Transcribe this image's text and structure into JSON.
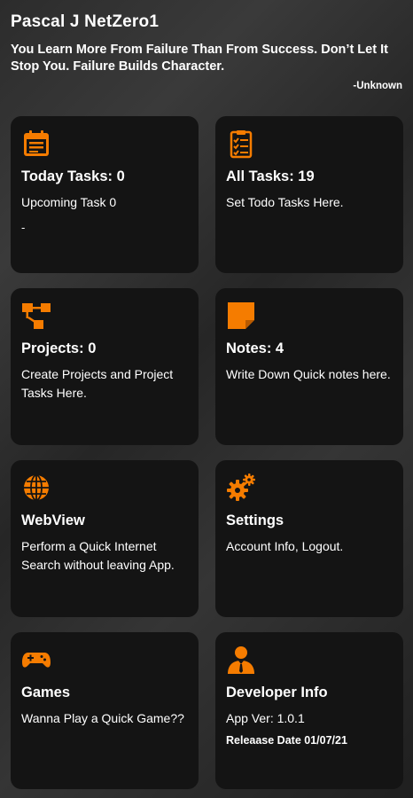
{
  "header": {
    "user_name": "Pascal J NetZero1",
    "quote": "You Learn More From Failure Than From Success. Don’t Let It Stop You. Failure Builds Character.",
    "author": "-Unknown"
  },
  "theme": {
    "accent": "#f57c00",
    "card_bg": "#141414"
  },
  "cards": [
    {
      "icon": "calendar-icon",
      "title": "Today Tasks: 0",
      "subtitle": "Upcoming Task 0",
      "extra": "-"
    },
    {
      "icon": "checklist-icon",
      "title": "All Tasks: 19",
      "subtitle": "Set Todo Tasks Here."
    },
    {
      "icon": "project-tree-icon",
      "title": "Projects: 0",
      "subtitle": "Create Projects and Project Tasks Here."
    },
    {
      "icon": "sticky-note-icon",
      "title": "Notes: 4",
      "subtitle": "Write Down Quick notes here."
    },
    {
      "icon": "globe-icon",
      "title": "WebView",
      "subtitle": "Perform a Quick Internet Search without leaving App."
    },
    {
      "icon": "gears-icon",
      "title": "Settings",
      "subtitle": "Account Info, Logout."
    },
    {
      "icon": "gamepad-icon",
      "title": "Games",
      "subtitle": "Wanna Play a Quick Game??"
    },
    {
      "icon": "developer-icon",
      "title": "Developer Info",
      "subtitle": "App Ver: 1.0.1",
      "extra": "Releaase Date 01/07/21"
    }
  ]
}
